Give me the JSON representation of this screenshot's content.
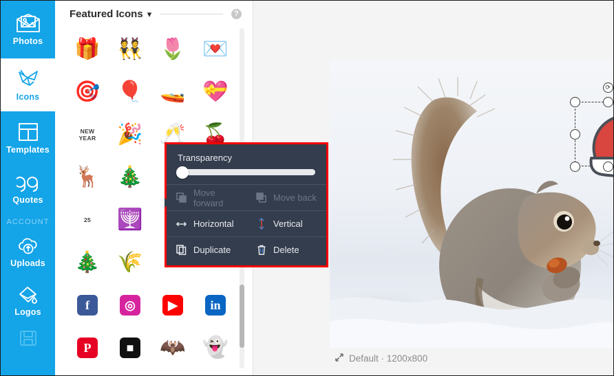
{
  "app": {
    "background_color": "#ffffff",
    "accent_blue": "#14a4e8",
    "menu_bg": "#343d4d",
    "annotation_red": "#f40000"
  },
  "sidebar": {
    "items": [
      {
        "id": "photos",
        "label": "Photos",
        "icon": "photo-envelope-icon",
        "active": false
      },
      {
        "id": "icons",
        "label": "Icons",
        "icon": "origami-bird-icon",
        "active": true
      },
      {
        "id": "templates",
        "label": "Templates",
        "icon": "layout-grid-icon",
        "active": false
      },
      {
        "id": "quotes",
        "label": "Quotes",
        "icon": "quote-marks-icon",
        "active": false
      }
    ],
    "section_label": "ACCOUNT",
    "account_items": [
      {
        "id": "uploads",
        "label": "Uploads",
        "icon": "cloud-upload-icon",
        "active": false
      },
      {
        "id": "logos",
        "label": "Logos",
        "icon": "logo-drop-icon",
        "active": false
      },
      {
        "id": "saved",
        "label": "",
        "icon": "floppy-save-icon",
        "active": false
      }
    ]
  },
  "panel": {
    "title": "Featured Icons",
    "chevron": "chevron-down-icon",
    "help": "?",
    "icons": [
      {
        "name": "gift-box-icon",
        "glyph": "🎁"
      },
      {
        "name": "dancing-couple-icon",
        "glyph": "👯"
      },
      {
        "name": "heart-flower-icon",
        "glyph": "🌷"
      },
      {
        "name": "love-letter-icon",
        "glyph": "💌"
      },
      {
        "name": "heart-target-icon",
        "glyph": "🎯"
      },
      {
        "name": "heart-balloon-icon",
        "glyph": "🎈"
      },
      {
        "name": "love-boat-icon",
        "glyph": "🚤"
      },
      {
        "name": "heart-confetti-icon",
        "glyph": "💝"
      },
      {
        "name": "new-year-text-icon",
        "text": "NEW\nYEAR"
      },
      {
        "name": "party-popper-icon",
        "glyph": "🎉"
      },
      {
        "name": "champagne-glass-icon",
        "glyph": "🥂"
      },
      {
        "name": "holly-berry-icon",
        "glyph": "🍒"
      },
      {
        "name": "reindeer-icon",
        "glyph": "🦌"
      },
      {
        "name": "christmas-tree-icon",
        "glyph": "🎄"
      },
      {
        "name": "blank-cell",
        "glyph": ""
      },
      {
        "name": "blank-cell",
        "glyph": ""
      },
      {
        "name": "calendar-25-icon",
        "text": "25"
      },
      {
        "name": "menorah-icon",
        "glyph": "🕎"
      },
      {
        "name": "blank-cell",
        "glyph": ""
      },
      {
        "name": "blank-cell",
        "glyph": ""
      },
      {
        "name": "christmas-ornament-icon",
        "glyph": "🎄"
      },
      {
        "name": "cornucopia-icon",
        "glyph": "🌾"
      },
      {
        "name": "blank-cell",
        "glyph": ""
      },
      {
        "name": "blank-cell",
        "glyph": ""
      },
      {
        "name": "facebook-icon",
        "badge": "f",
        "color": "#3b5998"
      },
      {
        "name": "instagram-icon",
        "badge": "◎",
        "color": "#d6249f"
      },
      {
        "name": "youtube-icon",
        "badge": "▶",
        "color": "#ff0000"
      },
      {
        "name": "linkedin-icon",
        "badge": "in",
        "color": "#0a66c2"
      },
      {
        "name": "pinterest-icon",
        "badge": "P",
        "color": "#e60023"
      },
      {
        "name": "snapchat-icon",
        "badge": "■",
        "color": "#111111"
      },
      {
        "name": "bat-icon",
        "glyph": "🦇"
      },
      {
        "name": "ghost-icon",
        "glyph": "👻"
      }
    ]
  },
  "context_menu": {
    "transparency_label": "Transparency",
    "transparency_value": 0,
    "move_forward_label": "Move forward",
    "move_forward_enabled": false,
    "move_back_label": "Move back",
    "move_back_enabled": false,
    "horizontal_label": "Horizontal",
    "vertical_label": "Vertical",
    "duplicate_label": "Duplicate",
    "delete_label": "Delete"
  },
  "canvas": {
    "caption_icon": "resize-arrows-icon",
    "caption": "Default · 1200x800",
    "selected_object": "santa-hat-sticker",
    "rotate_handle_icon": "rotate-icon",
    "annotation": "red-arrow-pointing-to-top-left-handle"
  }
}
